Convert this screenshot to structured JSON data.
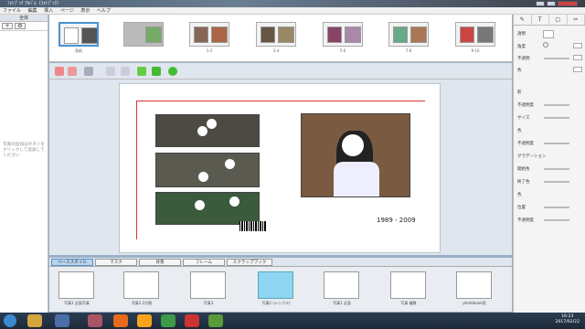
{
  "window": {
    "title": "ﾌｫﾄﾌﾞｯｸ ｱﾙﾊﾞﾑ（ﾌｫﾄﾌﾞｯｸ）"
  },
  "menu": [
    "ファイル",
    "編集",
    "挿入",
    "ページ",
    "表示",
    "ヘルプ"
  ],
  "left_panel": {
    "header": "全体",
    "hint": "写真の追加はボタンをクリックして追加してください"
  },
  "pages": [
    {
      "label": "表紙"
    },
    {
      "label": ""
    },
    {
      "label": "1-2"
    },
    {
      "label": "3-4"
    },
    {
      "label": "5-6"
    },
    {
      "label": "7-8"
    },
    {
      "label": "9-10"
    }
  ],
  "spread": {
    "caption": "1989 - 2009"
  },
  "tabs": [
    "ベーススタイル",
    "マスク",
    "背景",
    "フレーム",
    "スクラップブック"
  ],
  "layouts": [
    "写真1 全面写真",
    "写真2 2分割",
    "写真3",
    "写真1 (シンプル)",
    "写真1 全面",
    "写真 複数",
    "photobook用"
  ],
  "right_panel": {
    "tabs": [
      "✎",
      "T",
      "▢",
      "✂"
    ],
    "props": [
      "透明",
      "角度",
      "不透明",
      "色",
      "影",
      "不透明度",
      "サイズ",
      "色",
      "不透明度",
      "グラデーション",
      "開始色",
      "終了色",
      "色",
      "位置",
      "不透明度"
    ]
  },
  "taskbar": {
    "time": "16:23",
    "date": "2017/02/22"
  }
}
